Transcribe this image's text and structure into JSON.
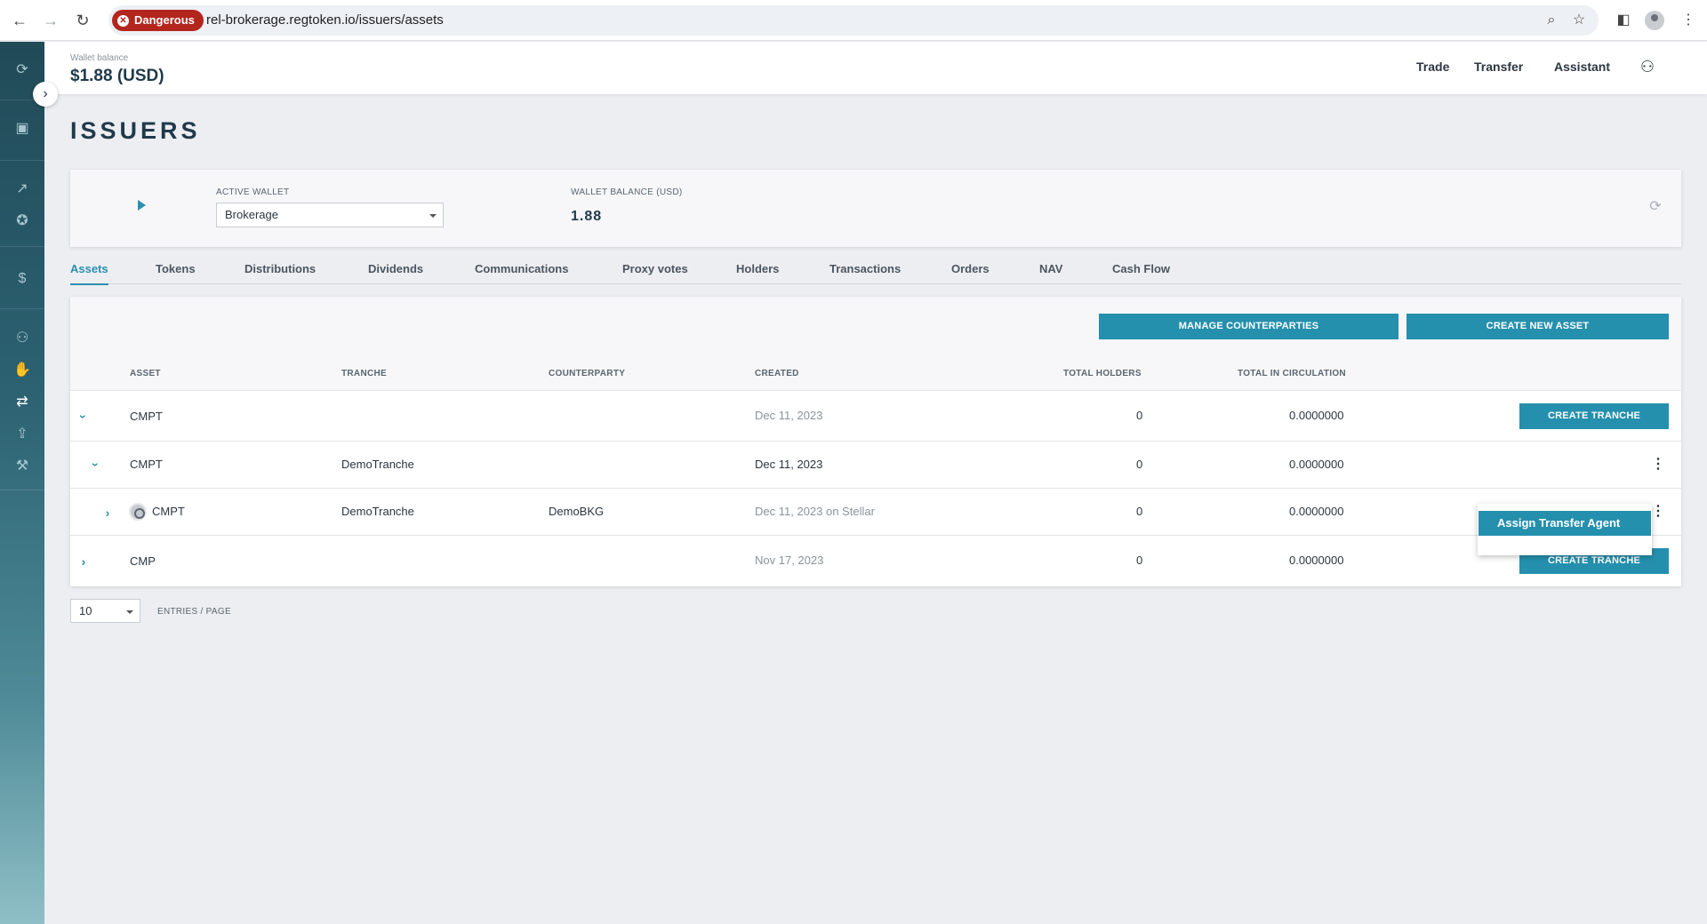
{
  "browser": {
    "security_badge": "Dangerous",
    "url": "rel-brokerage.regtoken.io/issuers/assets"
  },
  "sidebar": {
    "icons": [
      "sync-icon",
      "wallet-icon",
      "trend-icon",
      "badge-icon",
      "dollar-icon",
      "people-icon",
      "handshake-icon",
      "user-transfer-icon",
      "inbox-upload-icon",
      "tools-icon"
    ],
    "active": "user-transfer-icon"
  },
  "header": {
    "wallet_balance_label": "Wallet balance",
    "wallet_balance_value": "$1.88 (USD)",
    "nav": [
      "Trade",
      "Transfer",
      "Assistant"
    ]
  },
  "page": {
    "title": "ISSUERS"
  },
  "wallet": {
    "active_wallet_label": "ACTIVE WALLET",
    "active_wallet_value": "Brokerage",
    "balance_label": "WALLET BALANCE (USD)",
    "balance_value": "1.88"
  },
  "tabs": [
    "Assets",
    "Tokens",
    "Distributions",
    "Dividends",
    "Communications",
    "Proxy votes",
    "Holders",
    "Transactions",
    "Orders",
    "NAV",
    "Cash Flow"
  ],
  "active_tab": "Assets",
  "toolbar": {
    "manage_counterparties": "MANAGE COUNTERPARTIES",
    "create_new_asset": "CREATE NEW ASSET"
  },
  "table": {
    "columns": [
      "ASSET",
      "TRANCHE",
      "COUNTERPARTY",
      "CREATED",
      "TOTAL HOLDERS",
      "TOTAL IN CIRCULATION"
    ],
    "rows": [
      {
        "asset": "CMPT",
        "tranche": "",
        "counterparty": "",
        "created": "Dec 11, 2023",
        "holders": "0",
        "circulation": "0.0000000",
        "action": "CREATE TRANCHE",
        "expanded": true
      },
      {
        "asset": "CMPT",
        "tranche": "DemoTranche",
        "counterparty": "",
        "created": "Dec 11, 2023",
        "holders": "0",
        "circulation": "0.0000000",
        "expanded": true
      },
      {
        "asset": "CMPT",
        "tranche": "DemoTranche",
        "counterparty": "DemoBKG",
        "created": "Dec 11, 2023 on Stellar",
        "holders": "0",
        "circulation": "0.0000000",
        "expanded": false
      },
      {
        "asset": "CMP",
        "tranche": "",
        "counterparty": "",
        "created": "Nov 17, 2023",
        "holders": "0",
        "circulation": "0.0000000",
        "action": "CREATE TRANCHE",
        "expanded": false
      }
    ]
  },
  "popup": {
    "item": "Assign Transfer Agent"
  },
  "pagination": {
    "page_size": "10",
    "label": "ENTRIES / PAGE"
  },
  "colors": {
    "accent": "#2590ad",
    "danger": "#b3261e",
    "sidebar_top": "#214a58",
    "sidebar_bottom": "#8fbfc6"
  }
}
